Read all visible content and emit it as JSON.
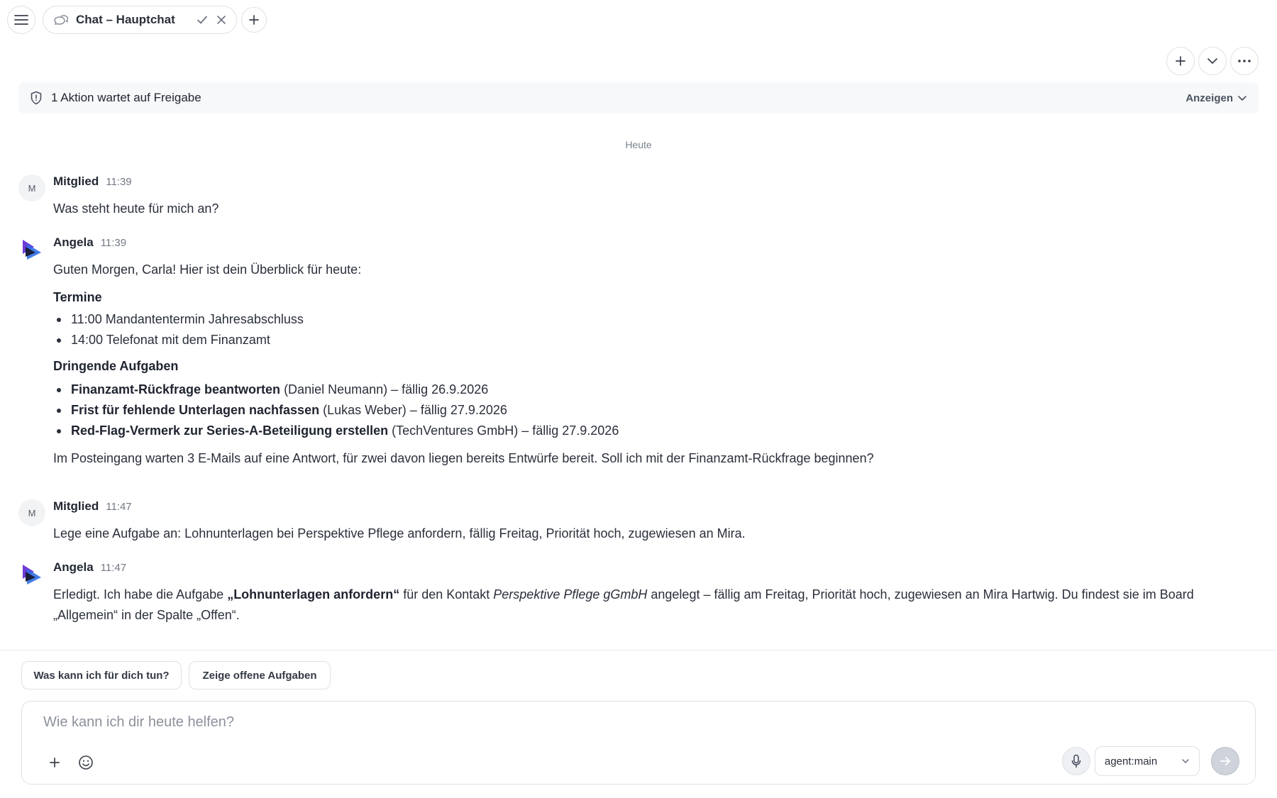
{
  "tabbar": {
    "tab_title": "Chat – Hauptchat"
  },
  "banner": {
    "text": "1 Aktion wartet auf Freigabe",
    "action_label": "Anzeigen"
  },
  "day_separator": "Heute",
  "messages": [
    {
      "author": "Mitglied",
      "avatar": "M",
      "time": "11:39",
      "text": "Was steht heute für mich an?"
    },
    {
      "author": "Angela",
      "time": "11:39",
      "intro": "Guten Morgen, Carla! Hier ist dein Überblick für heute:",
      "section1_title": "Termine",
      "appointments": [
        "11:00 Mandantentermin Jahresabschluss",
        "14:00 Telefonat mit dem Finanzamt"
      ],
      "section2_title": "Dringende Aufgaben",
      "tasks": [
        {
          "title": "Finanzamt-Rückfrage beantworten",
          "detail": "(Daniel Neumann) – fällig 26.9.2026"
        },
        {
          "title": "Frist für fehlende Unterlagen nachfassen",
          "detail": "(Lukas Weber) – fällig 27.9.2026"
        },
        {
          "title": "Red-Flag-Vermerk zur Series-A-Beteiligung erstellen",
          "detail": "(TechVentures GmbH) – fällig 27.9.2026"
        }
      ],
      "outro": "Im Posteingang warten 3 E-Mails auf eine Antwort, für zwei davon liegen bereits Entwürfe bereit. Soll ich mit der Finanzamt-Rückfrage beginnen?"
    },
    {
      "author": "Mitglied",
      "avatar": "M",
      "time": "11:47",
      "text": "Lege eine Aufgabe an: Lohnunterlagen bei Perspektive Pflege anfordern, fällig Freitag, Priorität hoch, zugewiesen an Mira."
    },
    {
      "author": "Angela",
      "time": "11:47",
      "part1": "Erledigt. Ich habe die Aufgabe ",
      "task_bold": "„Lohnunterlagen anfordern“",
      "part2": " für den Kontakt ",
      "contact_italic": "Perspektive Pflege gGmbH",
      "part3": " angelegt – fällig am Freitag, Priorität hoch, zugewiesen an Mira Hartwig. Du findest sie im Board „Allgemein“ in der Spalte „Offen“."
    }
  ],
  "suggestions": [
    "Was kann ich für dich tun?",
    "Zeige offene Aufgaben"
  ],
  "composer": {
    "placeholder": "Wie kann ich dir heute helfen?",
    "agent": "agent:main"
  },
  "colors": {
    "accent_purple": "#6d3bd6",
    "accent_blue": "#2f6fe4"
  }
}
